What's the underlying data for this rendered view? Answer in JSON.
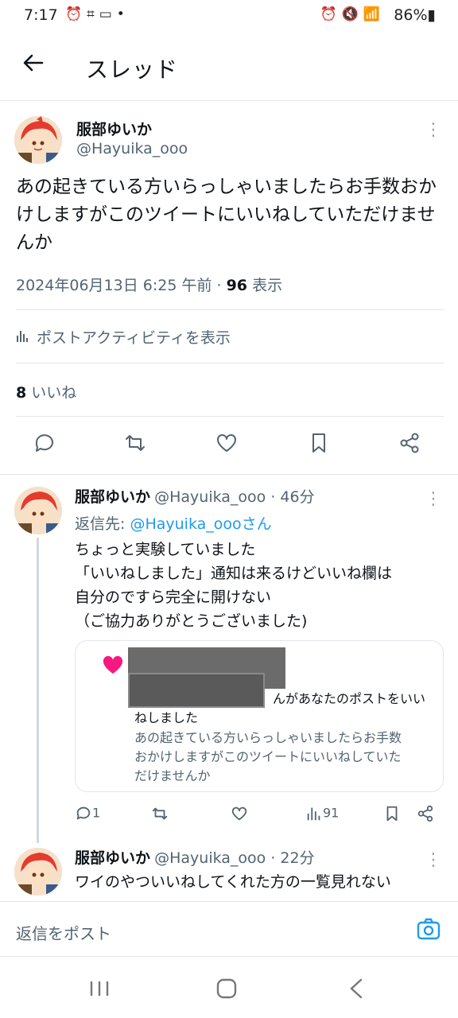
{
  "status_bar": {
    "time": "7:17",
    "battery": "86%"
  },
  "header": {
    "title": "スレッド"
  },
  "main_post": {
    "name": "服部ゆいか",
    "handle": "@Hayuika_ooo",
    "text": "あの起きている方いらっしゃいましたらお手数おかけしますがこのツイートにいいねしていただけませんか",
    "datetime": "2024年06月13日 6:25 午前 · ",
    "views": "96",
    "views_label": " 表示",
    "activity_label": "ポストアクティビティを表示",
    "likes_count": "8",
    "likes_label": " いいね"
  },
  "reply1": {
    "name": "服部ゆいか",
    "handle": "@Hayuika_ooo · 46分",
    "reply_prefix": "返信先: ",
    "reply_to": "@Hayuika_oooさん",
    "lines": [
      "ちょっと実験していました",
      "「いいねしました」通知は来るけどいいね欄は",
      "自分のですら完全に開けない",
      "（ご協力ありがとうございました)"
    ],
    "card": {
      "notif_line1": "んがあなたのポストをいい",
      "notif_line2": "ねしました",
      "quoted_line1": "あの起きている方いらっしゃいましたらお手数",
      "quoted_line2": "おかけしますがこのツイートにいいねしていた",
      "quoted_line3": "だけませんか"
    },
    "reply_count": "1",
    "views": "91"
  },
  "reply2": {
    "name": "服部ゆいか",
    "handle": "@Hayuika_ooo · 22分",
    "text": "ワイのやついいねしてくれた方の一覧見れない"
  },
  "composer": {
    "placeholder": "返信をポスト"
  },
  "colors": {
    "accent": "#1d9bf0",
    "heart": "#f91880"
  }
}
